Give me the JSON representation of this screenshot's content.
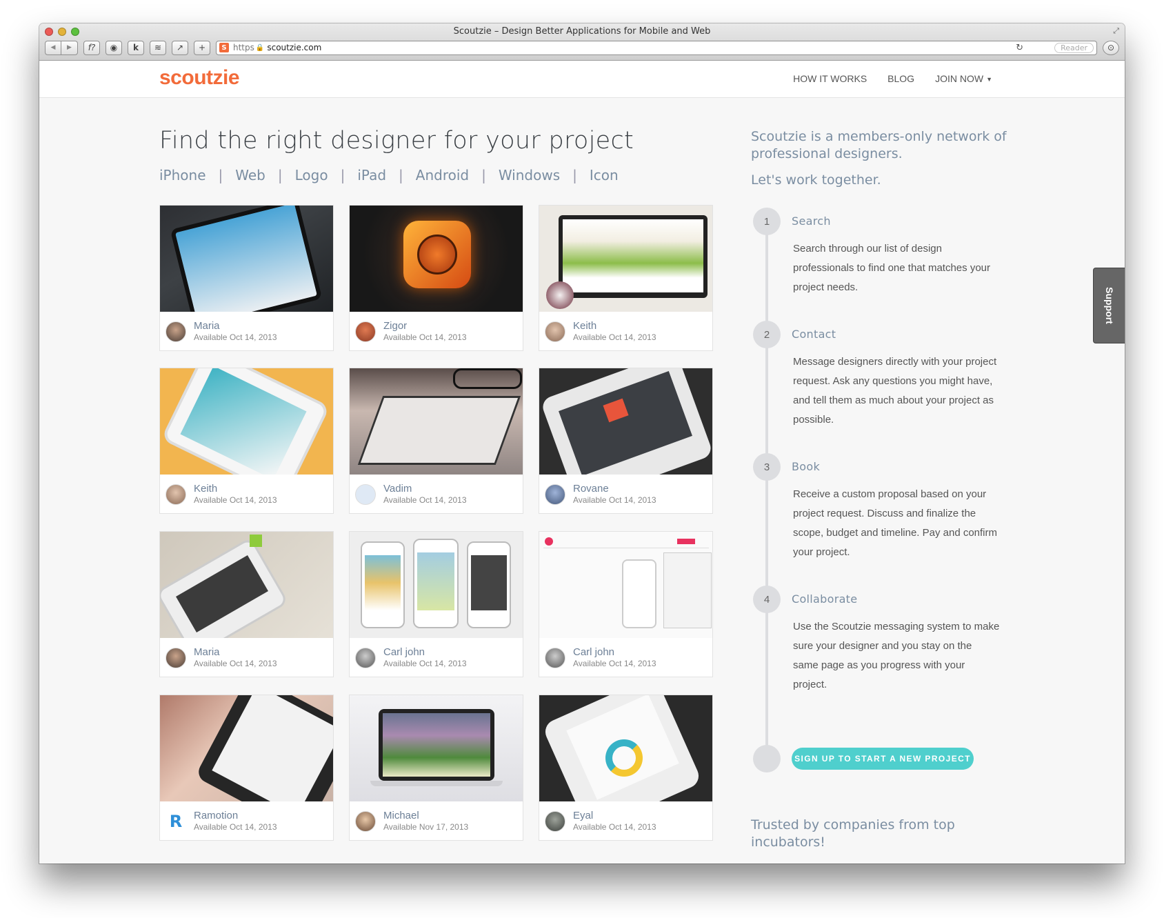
{
  "window": {
    "title": "Scoutzie – Design Better Applications for Mobile and Web",
    "url_scheme": "https",
    "url": "scoutzie.com",
    "reader_label": "Reader",
    "favicon_letter": "S"
  },
  "toolbar_icons": [
    "back-icon",
    "forward-icon",
    "fonts-icon",
    "circle-icon",
    "k-icon",
    "layers-icon",
    "share-icon",
    "add-tab-icon"
  ],
  "toolbar_glyphs": {
    "back": "◀",
    "forward": "▶",
    "fonts": "f?",
    "circle": "◉",
    "k": "k",
    "layers": "≋",
    "share": "↗",
    "add": "+",
    "reload": "↻",
    "download": "⊙",
    "lock": "🔒",
    "resize": "⤢"
  },
  "site": {
    "logo": "scoutzie",
    "brand_color": "#f26b3a",
    "nav": [
      "HOW IT WORKS",
      "BLOG",
      "JOIN NOW"
    ]
  },
  "main": {
    "headline": "Find the right designer for your project",
    "filters": [
      "iPhone",
      "Web",
      "Logo",
      "iPad",
      "Android",
      "Windows",
      "Icon"
    ],
    "cards": [
      {
        "name": "Maria",
        "available": "Available Oct 14, 2013"
      },
      {
        "name": "Zigor",
        "available": "Available Oct 14, 2013"
      },
      {
        "name": "Keith",
        "available": "Available Oct 14, 2013"
      },
      {
        "name": "Keith",
        "available": "Available Oct 14, 2013"
      },
      {
        "name": "Vadim",
        "available": "Available Oct 14, 2013"
      },
      {
        "name": "Rovane",
        "available": "Available Oct 14, 2013"
      },
      {
        "name": "Maria",
        "available": "Available Oct 14, 2013"
      },
      {
        "name": "Carl john",
        "available": "Available Oct 14, 2013"
      },
      {
        "name": "Carl john",
        "available": "Available Oct 14, 2013"
      },
      {
        "name": "Ramotion",
        "available": "Available Oct 14, 2013"
      },
      {
        "name": "Michael",
        "available": "Available Nov 17, 2013"
      },
      {
        "name": "Eyal",
        "available": "Available Oct 14, 2013"
      }
    ]
  },
  "sidebar": {
    "intro": "Scoutzie is a members-only network of professional designers.",
    "intro2": "Let's work together.",
    "steps": [
      {
        "num": "1",
        "title": "Search",
        "desc": "Search through our list of design professionals to find one that matches your project needs."
      },
      {
        "num": "2",
        "title": "Contact",
        "desc": "Message designers directly with your project request. Ask any questions you might have, and tell them as much about your project as possible."
      },
      {
        "num": "3",
        "title": "Book",
        "desc": "Receive a custom proposal based on your project request. Discuss and finalize the scope, budget and timeline. Pay and confirm your project."
      },
      {
        "num": "4",
        "title": "Collaborate",
        "desc": "Use the Scoutzie messaging system to make sure your designer and you stay on the same page as you progress with your project."
      }
    ],
    "cta": "SIGN UP TO START A NEW PROJECT",
    "cta_color": "#4fcfcd",
    "trusted": "Trusted by companies from top incubators!"
  },
  "support_label": "Support"
}
